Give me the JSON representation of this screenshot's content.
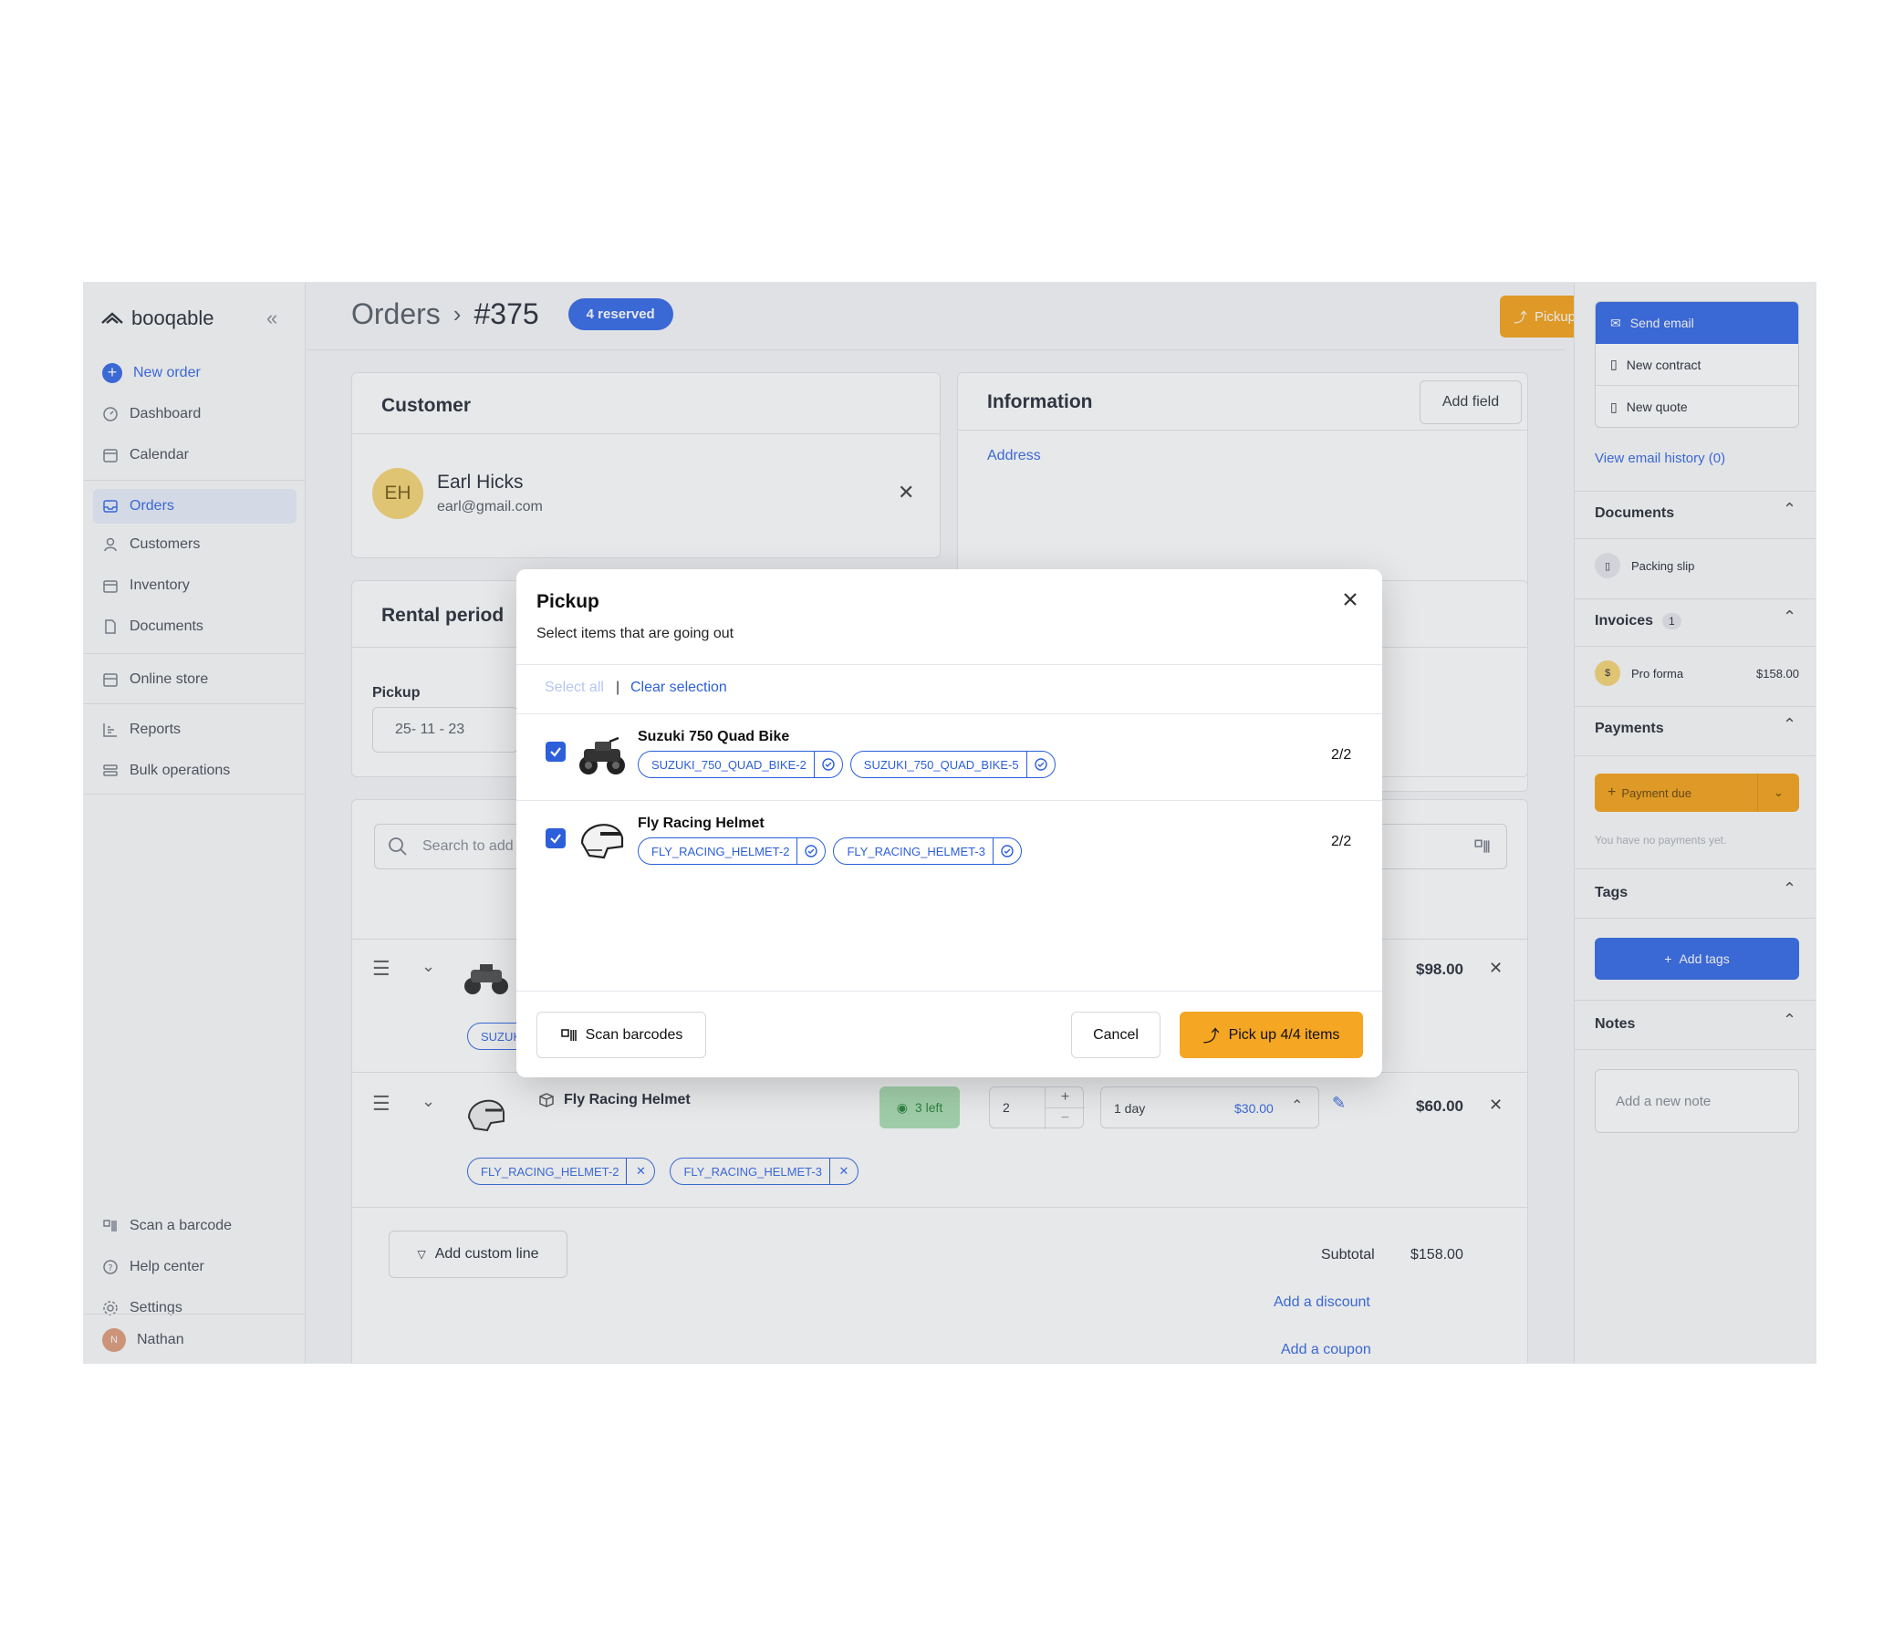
{
  "brand": {
    "name": "booqable"
  },
  "sidebar": {
    "new_order": "New order",
    "items": [
      {
        "label": "Dashboard",
        "icon": "dashboard-icon"
      },
      {
        "label": "Calendar",
        "icon": "calendar-icon"
      },
      {
        "label": "Orders",
        "icon": "orders-icon"
      },
      {
        "label": "Customers",
        "icon": "customers-icon"
      },
      {
        "label": "Inventory",
        "icon": "inventory-icon"
      },
      {
        "label": "Documents",
        "icon": "documents-icon"
      },
      {
        "label": "Online store",
        "icon": "store-icon"
      },
      {
        "label": "Reports",
        "icon": "reports-icon"
      },
      {
        "label": "Bulk operations",
        "icon": "bulk-icon"
      }
    ],
    "bottom": [
      {
        "label": "Scan a barcode"
      },
      {
        "label": "Help center"
      },
      {
        "label": "Settings"
      }
    ],
    "user": {
      "initial": "N",
      "name": "Nathan"
    }
  },
  "header": {
    "section": "Orders",
    "order_number": "#375",
    "status": "4 reserved",
    "pickup_label": "Pickup",
    "more_label": "···"
  },
  "customer": {
    "title": "Customer",
    "initials": "EH",
    "name": "Earl Hicks",
    "email": "earl@gmail.com"
  },
  "information": {
    "title": "Information",
    "add_field": "Add field",
    "address_label": "Address"
  },
  "rental": {
    "title": "Rental period",
    "pickup_label": "Pickup",
    "pickup_date": "25- 11 - 23"
  },
  "lines": {
    "search_placeholder": "Search to add",
    "line1": {
      "price": "$98.00",
      "tag_fragment": "SUZUK"
    },
    "line2": {
      "name": "Fly Racing Helmet",
      "availability": "3 left",
      "qty": "2",
      "duration": "1 day",
      "unit_price": "$30.00",
      "price": "$60.00",
      "tags": [
        "FLY_RACING_HELMET-2",
        "FLY_RACING_HELMET-3"
      ]
    },
    "add_custom_line": "Add custom line",
    "subtotal_label": "Subtotal",
    "subtotal_value": "$158.00",
    "add_discount": "Add a discount",
    "add_coupon": "Add a coupon"
  },
  "rpanel": {
    "send_email": "Send email",
    "new_contract": "New contract",
    "new_quote": "New quote",
    "email_history": "View email history (0)",
    "documents_title": "Documents",
    "packing_slip": "Packing slip",
    "invoices_title": "Invoices",
    "invoices_count": "1",
    "pro_forma": "Pro forma",
    "pro_forma_amount": "$158.00",
    "payments_title": "Payments",
    "payment_due": "Payment due",
    "no_payments": "You have no payments yet.",
    "tags_title": "Tags",
    "add_tags": "Add tags",
    "notes_title": "Notes",
    "note_placeholder": "Add a new note"
  },
  "modal": {
    "title": "Pickup",
    "subtitle": "Select items that are going out",
    "select_all": "Select all",
    "separator": "|",
    "clear_selection": "Clear selection",
    "products": [
      {
        "name": "Suzuki 750 Quad Bike",
        "tags": [
          "SUZUKI_750_QUAD_BIKE-2",
          "SUZUKI_750_QUAD_BIKE-5"
        ],
        "count": "2/2"
      },
      {
        "name": "Fly Racing Helmet",
        "tags": [
          "FLY_RACING_HELMET-2",
          "FLY_RACING_HELMET-3"
        ],
        "count": "2/2"
      }
    ],
    "scan_barcodes": "Scan barcodes",
    "cancel": "Cancel",
    "pick_up": "Pick up 4/4 items"
  },
  "colors": {
    "accent": "#2c5fd9",
    "pickup": "#f5a623",
    "available": "#34a853"
  }
}
